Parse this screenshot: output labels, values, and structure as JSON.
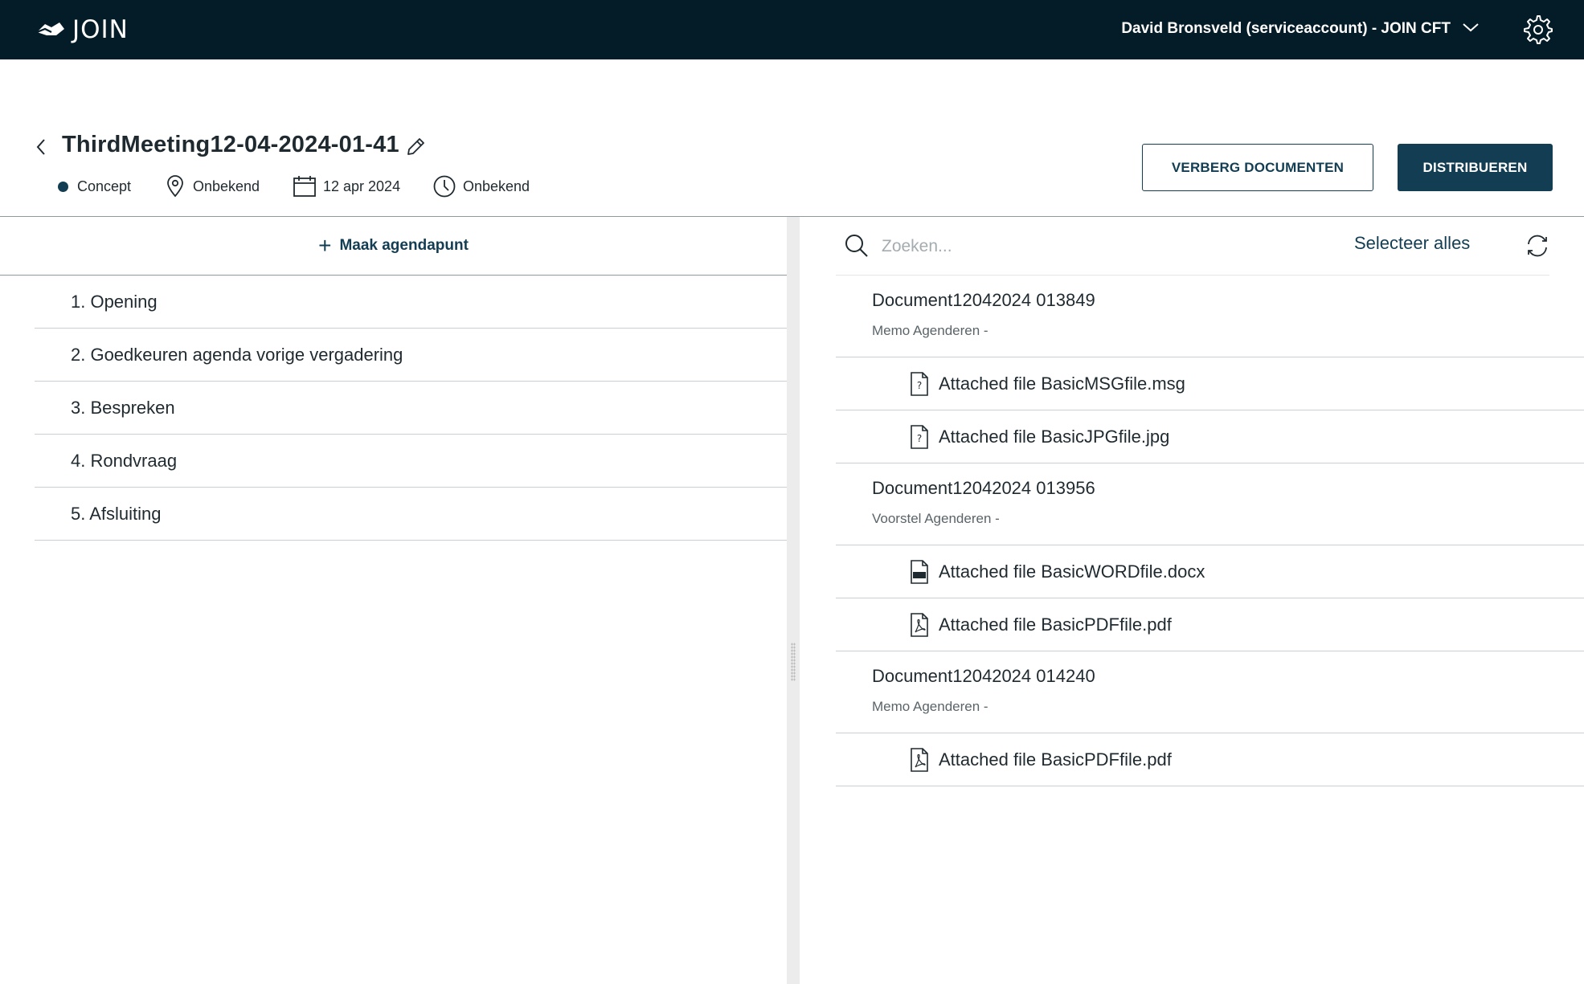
{
  "topbar": {
    "logo_text": "JOIN",
    "account_label": "David Bronsveld (serviceaccount) - JOIN CFT",
    "icons": {
      "logo": "join-logo-icon",
      "chevron": "chevron-down-icon",
      "settings": "gear-icon"
    }
  },
  "meeting": {
    "title": "ThirdMeeting12-04-2024-01-41",
    "status": "Concept",
    "location": "Onbekend",
    "date": "12 apr 2024",
    "time": "Onbekend",
    "colors": {
      "status_dot": "#123d52",
      "accent": "#123d52",
      "topbar": "#041c28"
    }
  },
  "actions": {
    "hide_documents": "VERBERG DOCUMENTEN",
    "distribute": "DISTRIBUEREN"
  },
  "agenda": {
    "add_label": "Maak agendapunt",
    "items": [
      {
        "label": "1. Opening"
      },
      {
        "label": "2. Goedkeuren agenda vorige vergadering"
      },
      {
        "label": "3. Bespreken"
      },
      {
        "label": "4. Rondvraag"
      },
      {
        "label": "5. Afsluiting"
      }
    ]
  },
  "documents": {
    "search_placeholder": "Zoeken...",
    "select_all": "Selecteer alles",
    "groups": [
      {
        "name": "Document12042024 013849",
        "subtitle": "Memo Agenderen -",
        "attachments": [
          {
            "name": "Attached file BasicMSGfile.msg",
            "icon": "unknown-file-icon"
          },
          {
            "name": "Attached file BasicJPGfile.jpg",
            "icon": "unknown-file-icon"
          }
        ]
      },
      {
        "name": "Document12042024 013956",
        "subtitle": "Voorstel Agenderen -",
        "attachments": [
          {
            "name": "Attached file BasicWORDfile.docx",
            "icon": "docx-file-icon"
          },
          {
            "name": "Attached file BasicPDFfile.pdf",
            "icon": "pdf-file-icon"
          }
        ]
      },
      {
        "name": "Document12042024 014240",
        "subtitle": "Memo Agenderen -",
        "attachments": [
          {
            "name": "Attached file BasicPDFfile.pdf",
            "icon": "pdf-file-icon"
          }
        ]
      }
    ]
  }
}
